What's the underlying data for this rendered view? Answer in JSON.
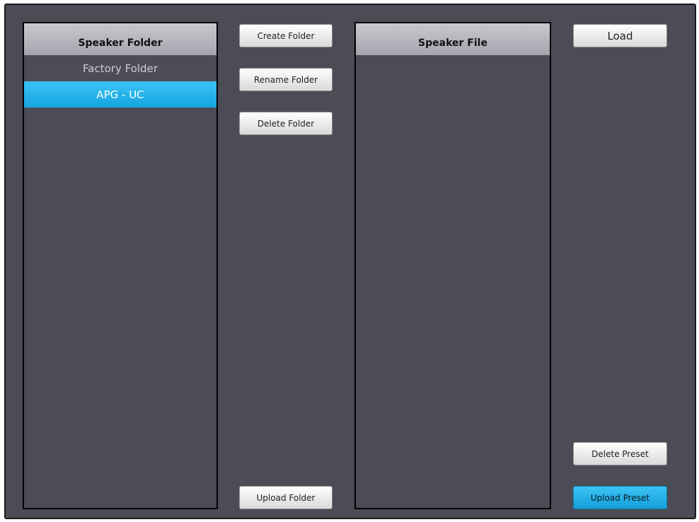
{
  "speaker_folder": {
    "header": "Speaker Folder",
    "items": [
      {
        "label": "Factory Folder",
        "selected": false
      },
      {
        "label": "APG - UC",
        "selected": true
      }
    ]
  },
  "speaker_file": {
    "header": "Speaker File",
    "items": []
  },
  "buttons": {
    "create_folder": "Create Folder",
    "rename_folder": "Rename Folder",
    "delete_folder": "Delete Folder",
    "upload_folder": "Upload Folder",
    "load": "Load",
    "delete_preset": "Delete Preset",
    "upload_preset": "Upload Preset"
  },
  "colors": {
    "background": "#4b4c55",
    "selected": "#29b6ec",
    "header": "#b9b7c0"
  }
}
